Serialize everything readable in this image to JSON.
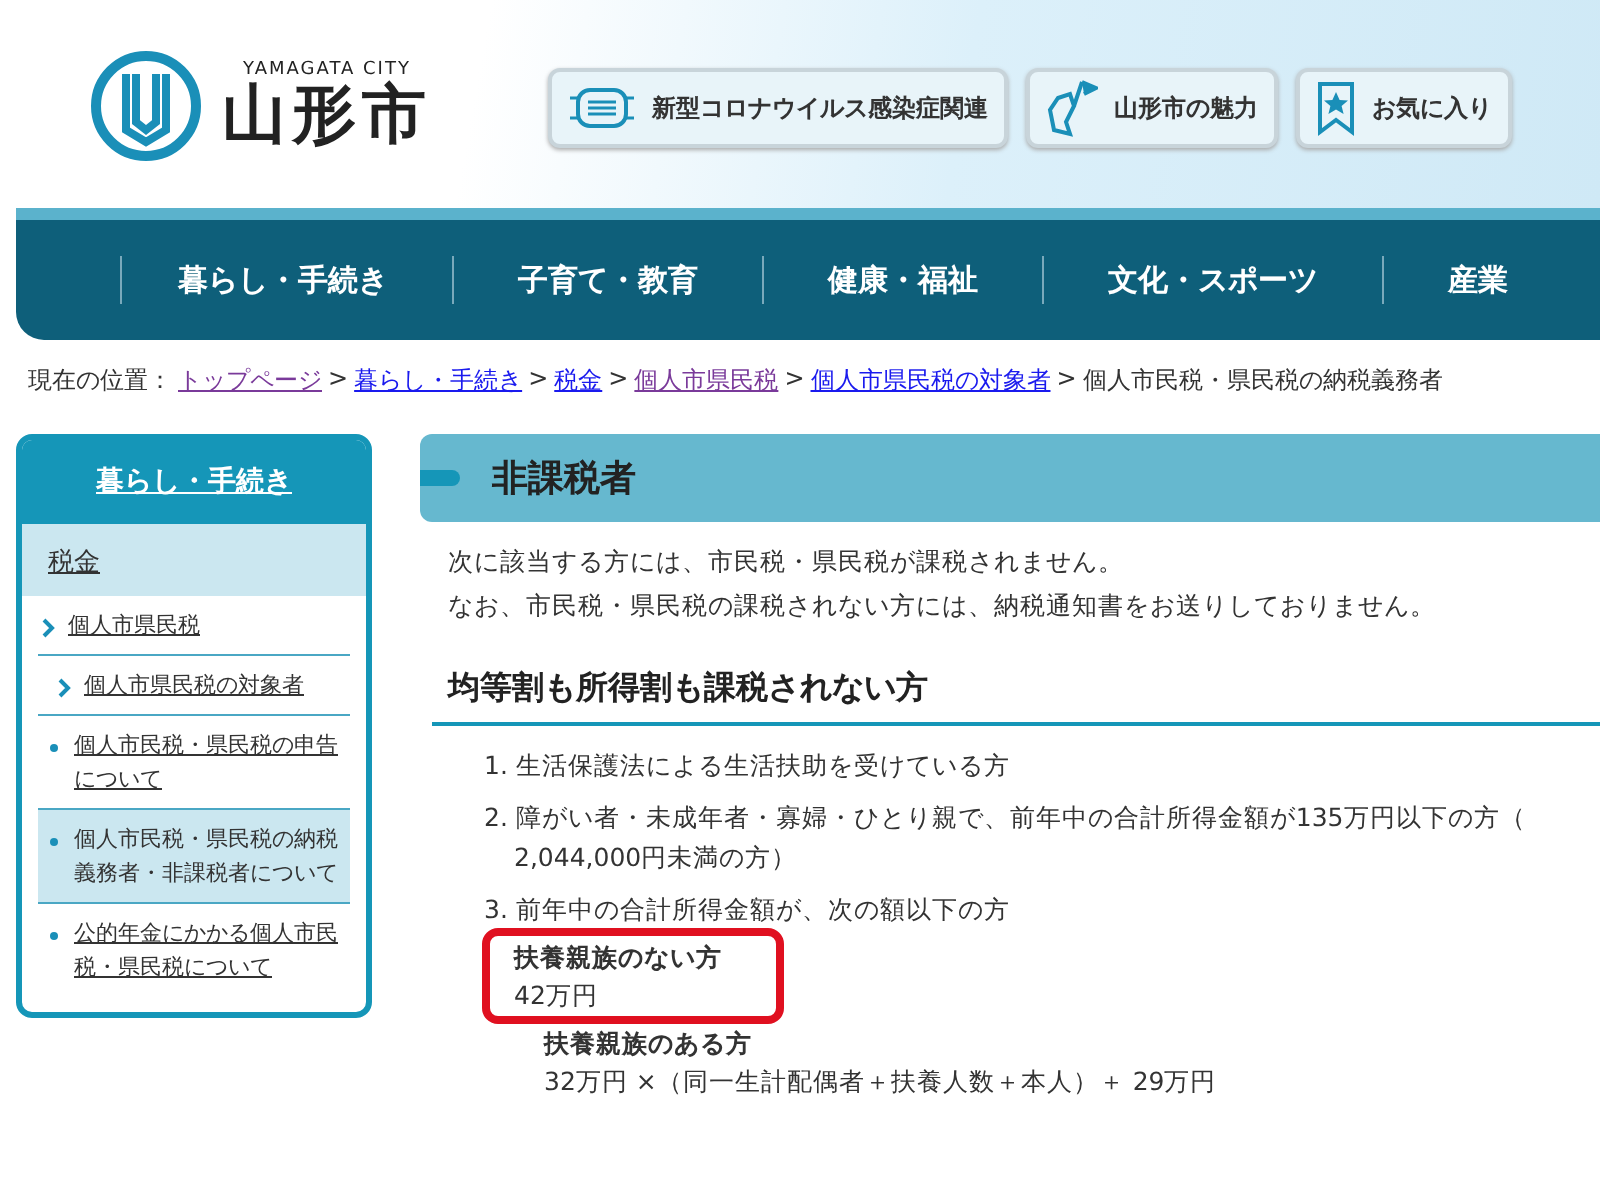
{
  "header": {
    "logo_latin": "YAMAGATA CITY",
    "logo_title": "山形市",
    "buttons": [
      {
        "label": "新型コロナウイルス感染症関連"
      },
      {
        "label": "山形市の魅力"
      },
      {
        "label": "お気に入り"
      }
    ]
  },
  "nav": {
    "items": [
      "暮らし・手続き",
      "子育て・教育",
      "健康・福祉",
      "文化・スポーツ",
      "産業"
    ]
  },
  "breadcrumb": {
    "label": "現在の位置：",
    "separator": ">",
    "links": [
      {
        "text": "トップページ",
        "visited": true
      },
      {
        "text": "暮らし・手続き",
        "visited": false
      },
      {
        "text": "税金",
        "visited": false
      },
      {
        "text": "個人市県民税",
        "visited": true
      },
      {
        "text": "個人市県民税の対象者",
        "visited": false
      }
    ],
    "current": "個人市民税・県民税の納税義務者"
  },
  "sidebar": {
    "title": "暮らし・手続き",
    "section": "税金",
    "items": [
      {
        "text": "個人市県民税",
        "kind": "chevron",
        "selected": false
      },
      {
        "text": "個人市県民税の対象者",
        "kind": "subchevron",
        "selected": false
      },
      {
        "text": "個人市民税・県民税の申告について",
        "kind": "bullet",
        "selected": false
      },
      {
        "text": "個人市民税・県民税の納税義務者・非課税者について",
        "kind": "bullet",
        "selected": true
      },
      {
        "text": "公的年金にかかる個人市民税・県民税について",
        "kind": "bullet",
        "selected": false
      }
    ]
  },
  "main": {
    "title": "非課税者",
    "intro": [
      "次に該当する方には、市民税・県民税が課税されません。",
      "なお、市民税・県民税の課税されない方には、納税通知書をお送りしておりません。"
    ],
    "heading": "均等割も所得割も課税されない方",
    "list": [
      {
        "lines": [
          "1. 生活保護法による生活扶助を受けている方"
        ]
      },
      {
        "lines": [
          "2. 障がい者・未成年者・寡婦・ひとり親で、前年中の合計所得金額が135万円以下の方（",
          "2,044,000円未満の方）"
        ]
      },
      {
        "lines": [
          "3. 前年中の合計所得金額が、次の額以下の方"
        ],
        "subs": [
          {
            "label": "扶養親族のない方",
            "value": "42万円",
            "highlighted": true
          },
          {
            "label": "扶養親族のある方",
            "value": "32万円 ×（同一生計配偶者＋扶養人数＋本人）＋ 29万円",
            "highlighted": false
          }
        ]
      }
    ]
  }
}
